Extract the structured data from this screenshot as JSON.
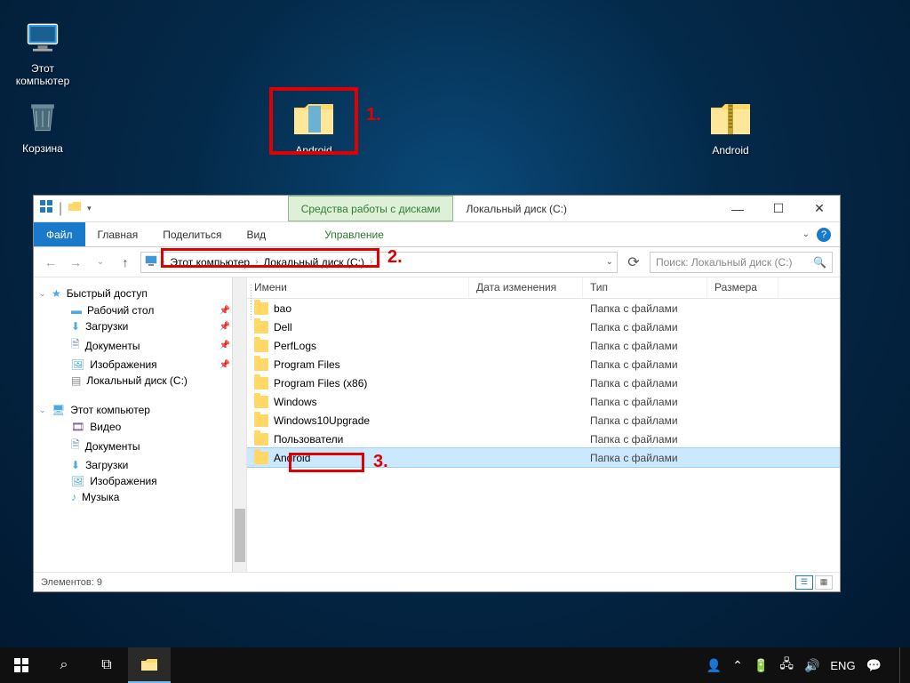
{
  "desktop": {
    "icons": [
      {
        "id": "this-pc",
        "label": "Этот компьютер"
      },
      {
        "id": "recycle",
        "label": "Корзина"
      },
      {
        "id": "android-folder",
        "label": "Android"
      },
      {
        "id": "android-zip",
        "label": "Android"
      }
    ]
  },
  "callouts": {
    "c1": "1.",
    "c2": "2.",
    "c3": "3."
  },
  "window": {
    "context_tab": "Средства работы с дисками",
    "title": "Локальный диск (C:)",
    "ribbon": {
      "file": "Файл",
      "home": "Главная",
      "share": "Поделиться",
      "view": "Вид",
      "manage": "Управление"
    },
    "breadcrumbs": {
      "pc": "Этот компьютер",
      "drive": "Локальный диск (C:)"
    },
    "search_placeholder": "Поиск: Локальный диск (C:)",
    "columns": {
      "name": "Имени",
      "date": "Дата изменения",
      "type": "Тип",
      "size": "Размера"
    },
    "sidebar": {
      "quick": "Быстрый доступ",
      "quick_items": [
        "Рабочий стол",
        "Загрузки",
        "Документы",
        "Изображения",
        "Локальный диск (C:)"
      ],
      "pc": "Этот компьютер",
      "pc_items": [
        "Видео",
        "Документы",
        "Загрузки",
        "Изображения",
        "Музыка"
      ]
    },
    "rows": [
      {
        "name": "bao",
        "type": "Папка с файлами"
      },
      {
        "name": "Dell",
        "type": "Папка с файлами"
      },
      {
        "name": "PerfLogs",
        "type": "Папка с файлами"
      },
      {
        "name": "Program Files",
        "type": "Папка с файлами"
      },
      {
        "name": "Program Files (x86)",
        "type": "Папка с файлами"
      },
      {
        "name": "Windows",
        "type": "Папка с файлами"
      },
      {
        "name": "Windows10Upgrade",
        "type": "Папка с файлами"
      },
      {
        "name": "Пользователи",
        "type": "Папка с файлами"
      },
      {
        "name": "Android",
        "type": "Папка с файлами",
        "selected": true
      }
    ],
    "status": "Элементов: 9"
  },
  "taskbar": {
    "lang": "ENG"
  }
}
